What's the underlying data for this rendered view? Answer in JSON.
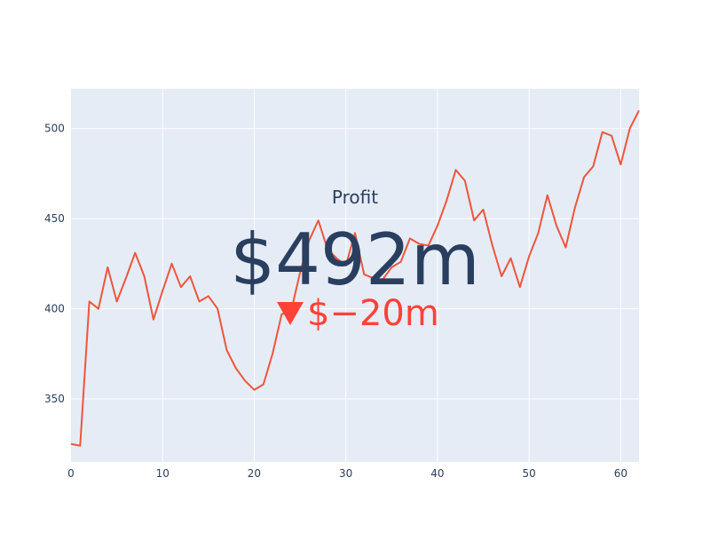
{
  "chart_data": {
    "type": "line",
    "x": [
      0,
      1,
      2,
      3,
      4,
      5,
      6,
      7,
      8,
      9,
      10,
      11,
      12,
      13,
      14,
      15,
      16,
      17,
      18,
      19,
      20,
      21,
      22,
      23,
      24,
      25,
      26,
      27,
      28,
      29,
      30,
      31,
      32,
      33,
      34,
      35,
      36,
      37,
      38,
      39,
      40,
      41,
      42,
      43,
      44,
      45,
      46,
      47,
      48,
      49,
      50,
      51,
      52,
      53,
      54,
      55,
      56,
      57,
      58,
      59,
      60,
      61,
      62
    ],
    "series": [
      {
        "values": [
          325,
          324,
          404,
          400,
          423,
          404,
          417,
          431,
          418,
          394,
          410,
          425,
          412,
          418,
          404,
          407,
          400,
          377,
          367,
          360,
          355,
          358,
          375,
          397,
          398,
          420,
          438,
          449,
          433,
          428,
          424,
          442,
          419,
          417,
          416,
          423,
          426,
          439,
          436,
          435,
          446,
          460,
          477,
          471,
          449,
          455,
          435,
          418,
          428,
          412,
          429,
          442,
          463,
          446,
          434,
          456,
          473,
          479,
          498,
          496,
          480,
          500,
          510
        ],
        "color": "#EF553B"
      }
    ],
    "xlim": [
      0,
      62
    ],
    "ylim": [
      315,
      522
    ],
    "xticks": [
      "0",
      "10",
      "20",
      "30",
      "40",
      "50",
      "60"
    ],
    "yticks": [
      "350",
      "400",
      "450",
      "500"
    ],
    "grid": true,
    "background": "#E5ECF6",
    "indicator": {
      "title": "Profit",
      "value": "$492m",
      "delta": "$−20m",
      "delta_direction": "down",
      "delta_color": "#FF4136",
      "value_color": "#2a3f5f"
    }
  }
}
